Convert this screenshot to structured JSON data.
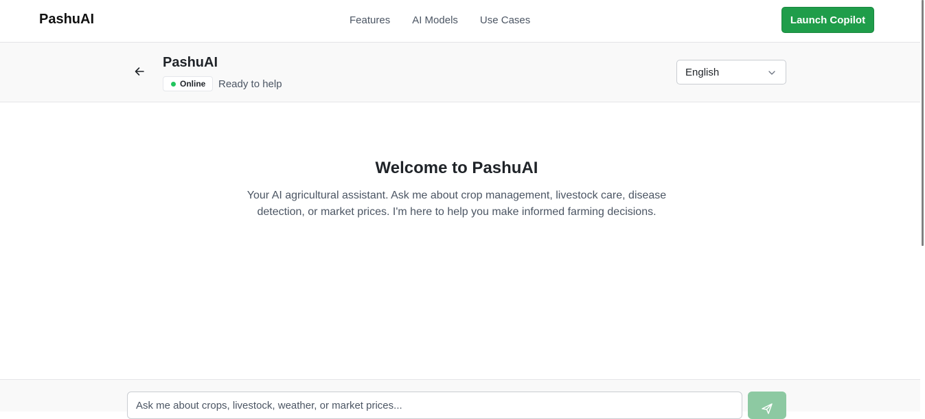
{
  "nav": {
    "brand": "PashuAI",
    "links": [
      "Features",
      "AI Models",
      "Use Cases"
    ],
    "launch_label": "Launch Copilot"
  },
  "chat": {
    "title": "PashuAI",
    "status_label": "Online",
    "status_text": "Ready to help",
    "language": "English"
  },
  "welcome": {
    "title": "Welcome to PashuAI",
    "text": "Your AI agricultural assistant. Ask me about crop management, livestock care, disease detection, or market prices. I'm here to help you make informed farming decisions."
  },
  "input": {
    "placeholder": "Ask me about crops, livestock, weather, or market prices..."
  },
  "colors": {
    "accent": "#1f9d4a",
    "online": "#22c55e",
    "send_disabled": "#8dc9a2"
  },
  "icons": {
    "back": "arrow-left-icon",
    "dropdown": "chevron-down-icon",
    "send": "send-icon"
  }
}
